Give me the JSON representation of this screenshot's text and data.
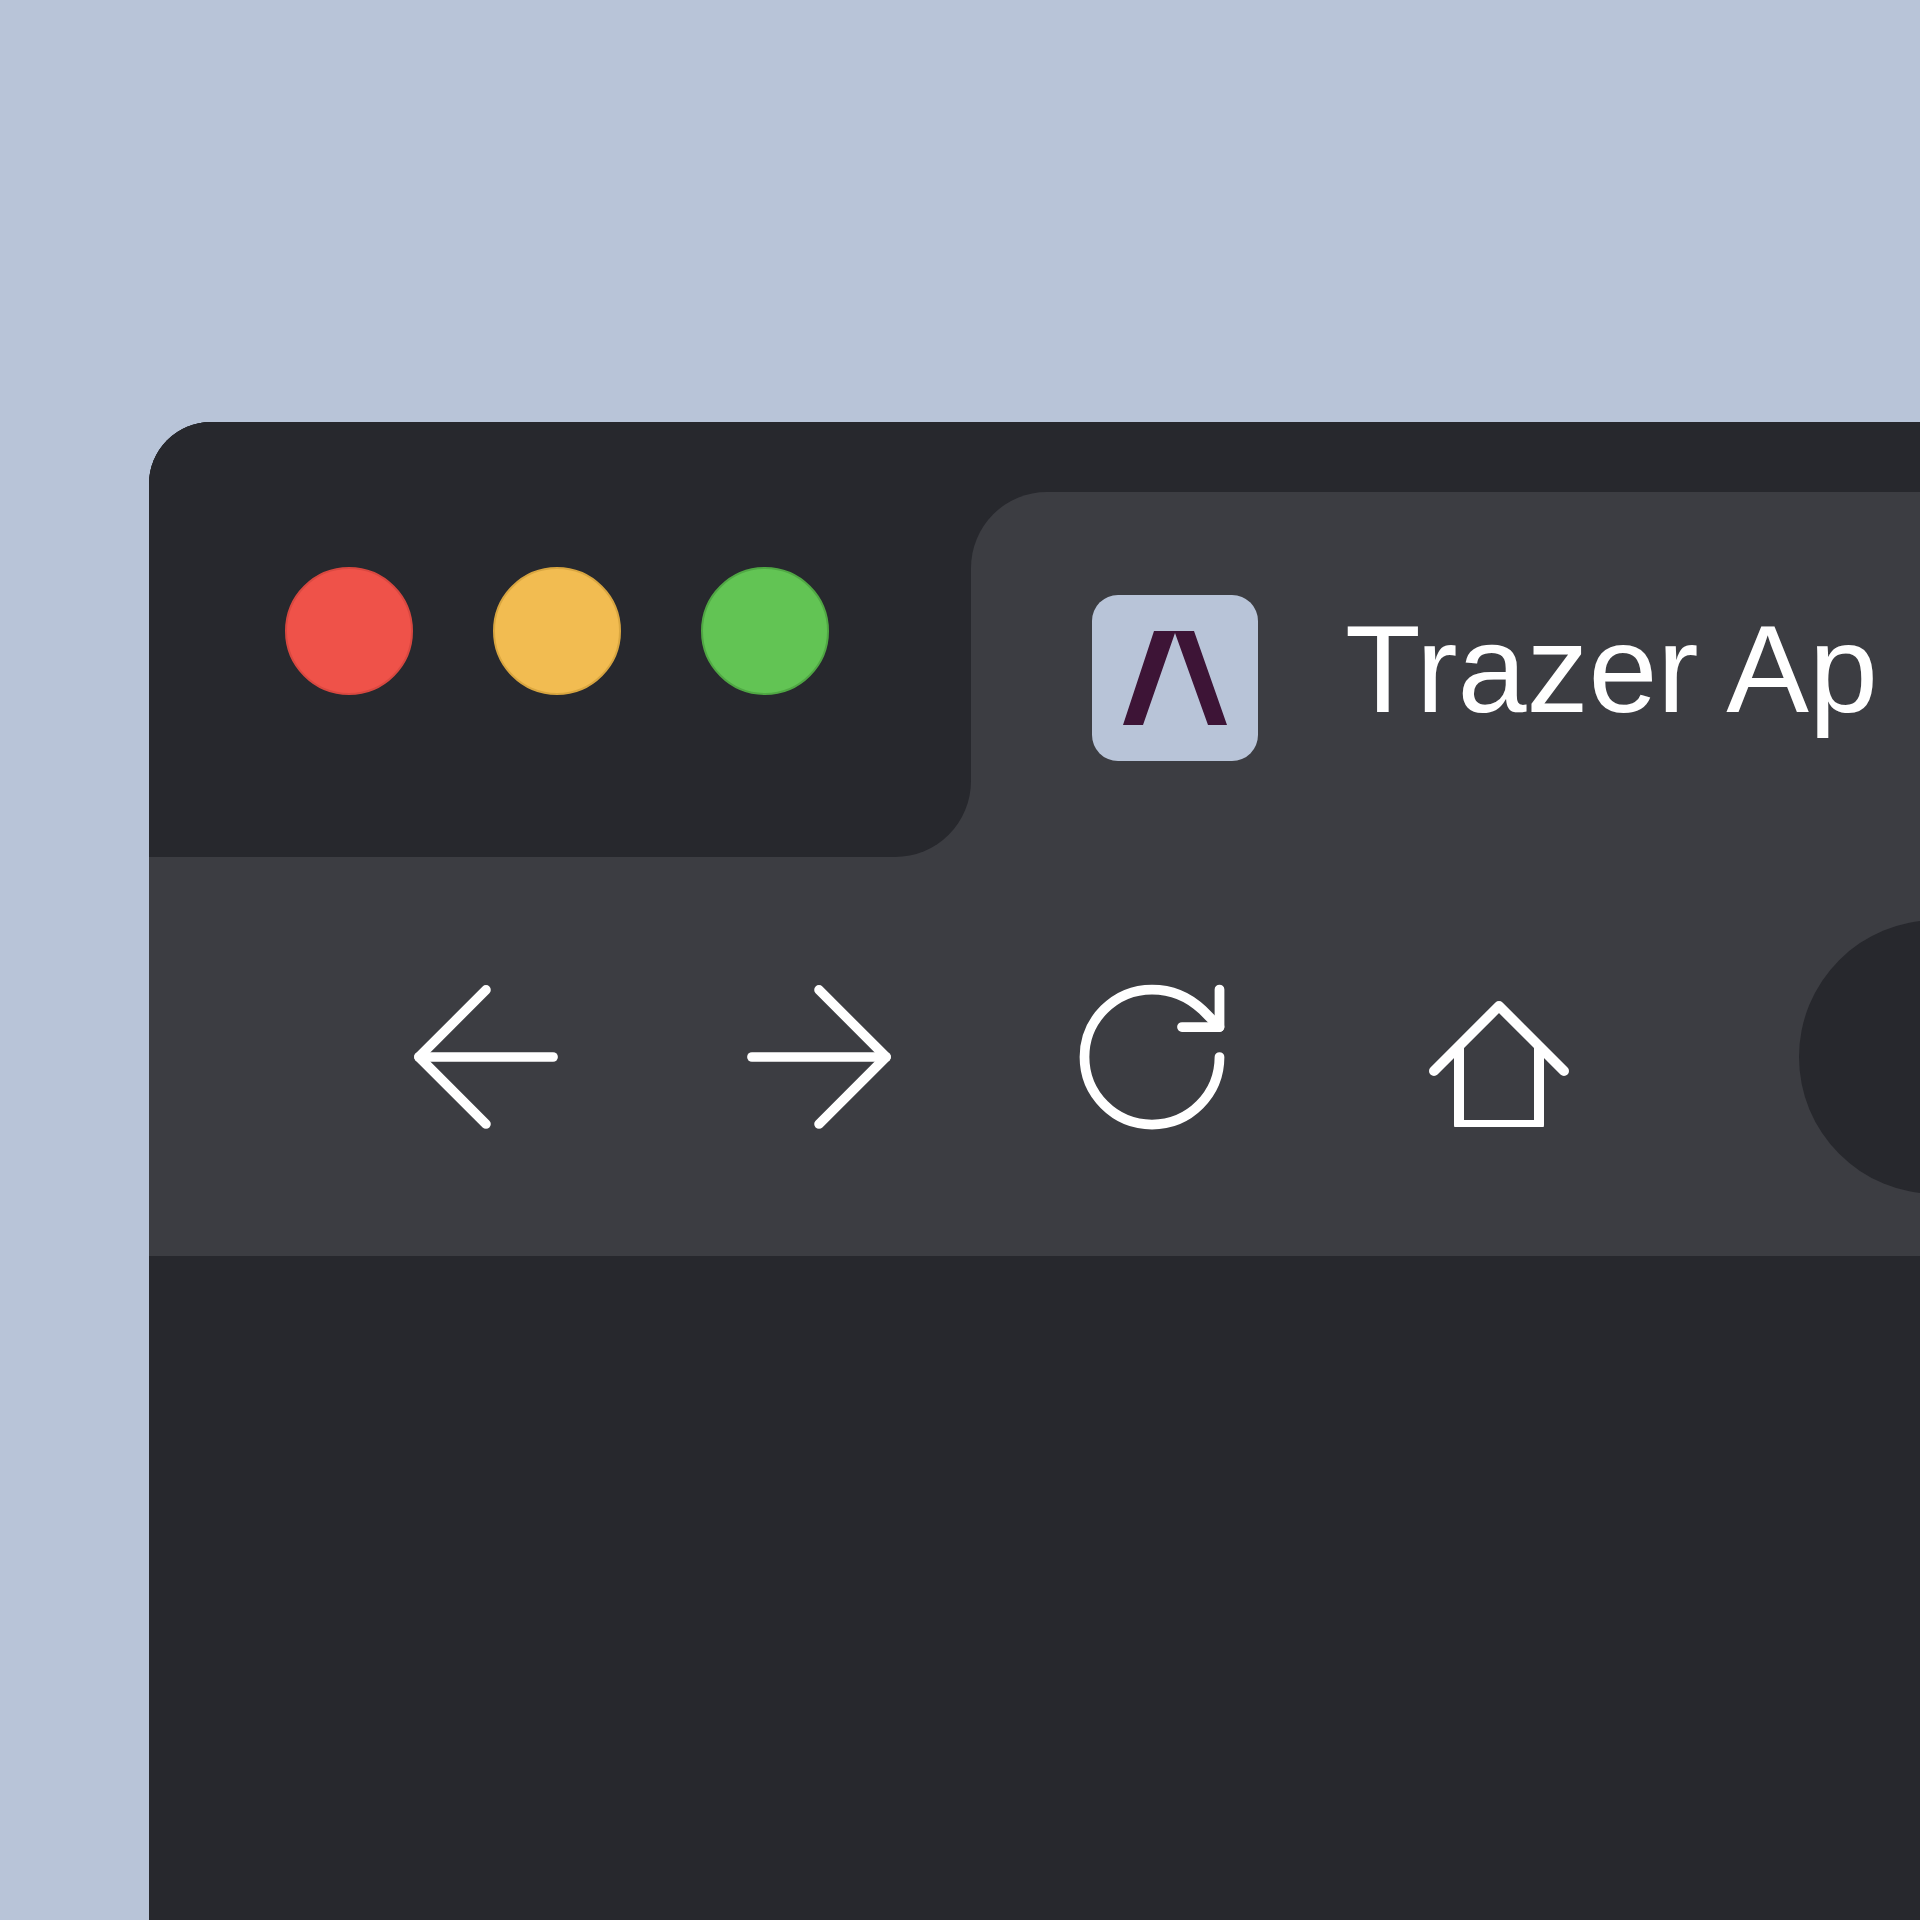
{
  "tab": {
    "title": "Trazer Ap"
  }
}
